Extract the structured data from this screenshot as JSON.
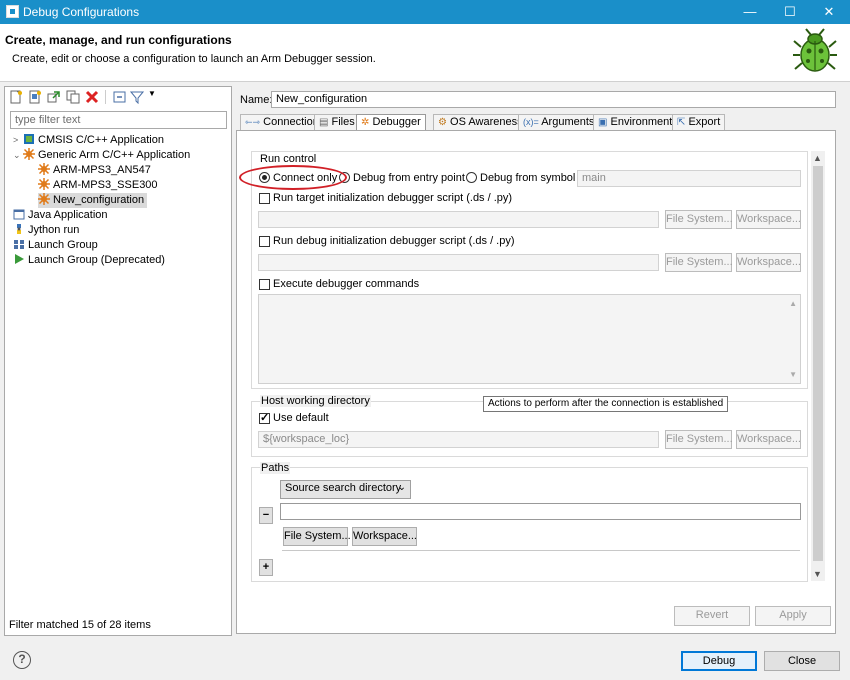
{
  "window": {
    "title": "Debug Configurations",
    "minimize": "—",
    "maximize": "☐",
    "close": "✕"
  },
  "header": {
    "title": "Create, manage, and run configurations",
    "subtitle": "Create, edit or choose a configuration to launch an Arm Debugger session."
  },
  "left": {
    "filter_placeholder": "type filter text",
    "tree": [
      {
        "label": "CMSIS C/C++ Application",
        "twisty": ">",
        "icon": "cmsis-app-icon"
      },
      {
        "label": "Generic Arm C/C++ Application",
        "twisty": "⌄",
        "icon": "arm-app-icon"
      },
      {
        "label": "ARM-MPS3_AN547",
        "icon": "arm-config-icon"
      },
      {
        "label": "ARM-MPS3_SSE300",
        "icon": "arm-config-icon"
      },
      {
        "label": "New_configuration",
        "icon": "arm-config-icon",
        "selected": true
      },
      {
        "label": "Java Application",
        "icon": "java-app-icon"
      },
      {
        "label": "Jython run",
        "icon": "jython-icon"
      },
      {
        "label": "Launch Group",
        "icon": "launch-group-icon"
      },
      {
        "label": "Launch Group (Deprecated)",
        "icon": "launch-group-deprecated-icon"
      }
    ],
    "status": "Filter matched 15 of 28 items"
  },
  "config": {
    "name_label": "Name:",
    "name_value": "New_configuration",
    "tabs": [
      "Connection",
      "Files",
      "Debugger",
      "OS Awareness",
      "Arguments",
      "Environment",
      "Export"
    ],
    "run_control": {
      "label": "Run control",
      "connect_only": "Connect only",
      "debug_entry": "Debug from entry point",
      "debug_symbol": "Debug from symbol",
      "symbol_value": "main",
      "target_init": "Run target initialization debugger script (.ds / .py)",
      "debug_init": "Run debug initialization debugger script (.ds / .py)",
      "file_system": "File System...",
      "workspace": "Workspace...",
      "execute_cmds": "Execute debugger commands"
    },
    "tooltip": "Actions to perform after the connection is established",
    "host_dir": {
      "label": "Host working directory",
      "use_default": "Use default",
      "value": "${workspace_loc}",
      "file_system": "File System...",
      "workspace": "Workspace..."
    },
    "paths": {
      "label": "Paths",
      "dropdown": "Source search directory",
      "minus": "−",
      "plus": "+",
      "file_system": "File System...",
      "workspace": "Workspace..."
    }
  },
  "buttons": {
    "revert": "Revert",
    "apply": "Apply",
    "debug": "Debug",
    "close": "Close",
    "help": "?"
  }
}
